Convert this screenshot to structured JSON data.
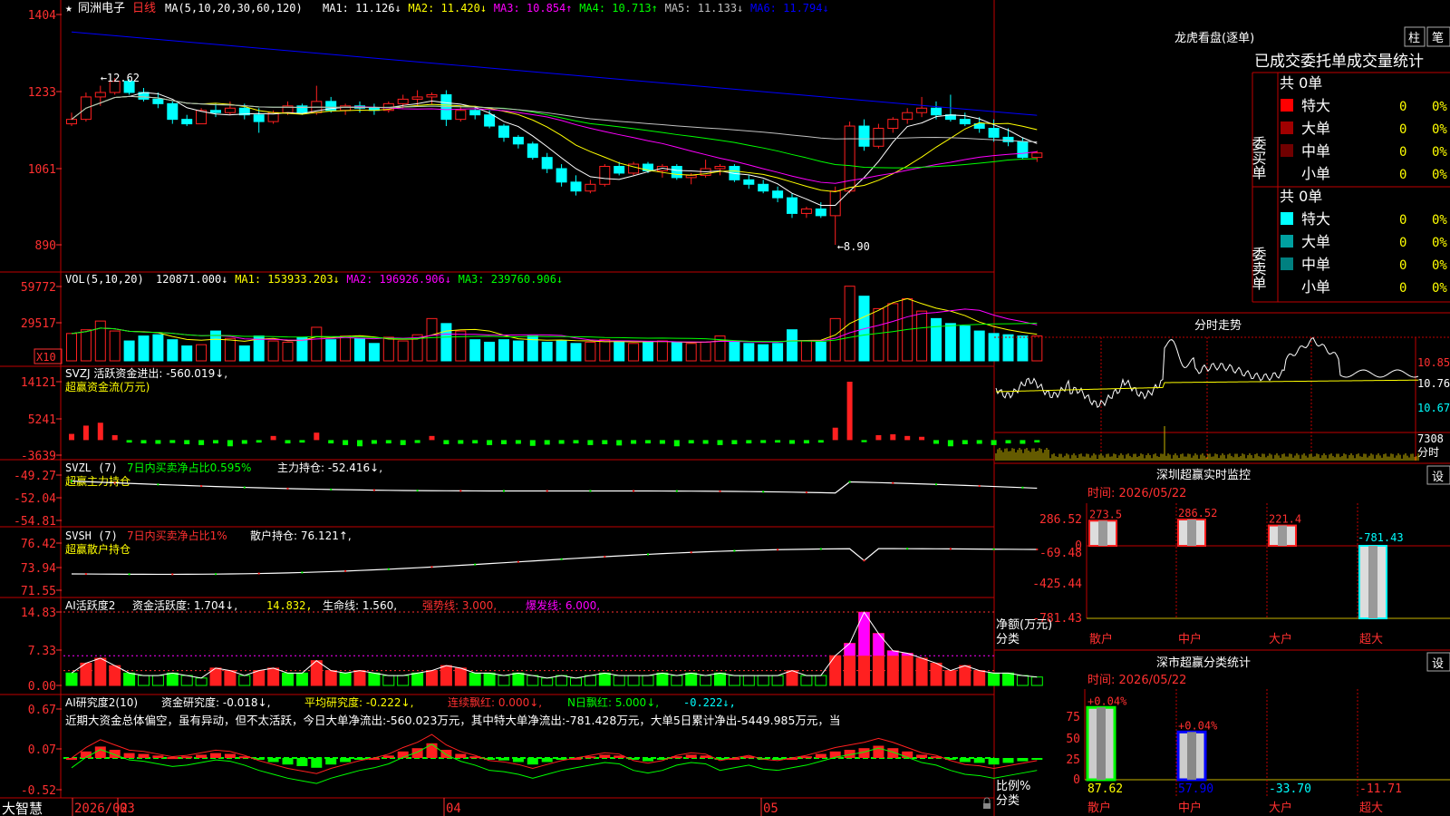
{
  "colors": {
    "up": "#ff2020",
    "down": "#00ffff",
    "ma5": "#ffffff",
    "ma10": "#ffff00",
    "ma20": "#ff00ff",
    "ma30": "#00ff00",
    "ma60": "#c0c0c0",
    "ma120": "#0000ff",
    "axis": "#c00000",
    "label_red": "#ff3030",
    "text_yellow": "#ffff00",
    "green": "#00ff00",
    "cyan": "#00ffff",
    "magenta": "#ff00ff"
  },
  "header": {
    "star": "★",
    "stock_name": "同洲电子",
    "period": "日线",
    "ma_caption": "MA(5,10,20,30,60,120)",
    "ma_values": [
      {
        "label": "MA1: 11.126↓",
        "color": "#ffffff"
      },
      {
        "label": "MA2: 11.420↓",
        "color": "#ffff00"
      },
      {
        "label": "MA3: 10.854↑",
        "color": "#ff00ff"
      },
      {
        "label": "MA4: 10.713↑",
        "color": "#00ff00"
      },
      {
        "label": "MA5: 11.133↓",
        "color": "#c0c0c0"
      },
      {
        "label": "MA6: 11.794↓",
        "color": "#0000ff"
      }
    ]
  },
  "price_panel": {
    "ticks": [
      "1404",
      "1233",
      "1061",
      "890"
    ],
    "high_label": "←12.62",
    "low_label": "←8.90"
  },
  "vol_panel": {
    "ticks": [
      "59772",
      "29517"
    ],
    "unit": "X10",
    "caption": "VOL(5,10,20)",
    "values": [
      {
        "label": "120871.000↓",
        "color": "#ffffff"
      },
      {
        "label": "MA1: 153933.203↓",
        "color": "#ffff00"
      },
      {
        "label": "MA2: 196926.906↓",
        "color": "#ff00ff"
      },
      {
        "label": "MA3: 239760.906↓",
        "color": "#00ff00"
      }
    ]
  },
  "svzj_panel": {
    "ticks": [
      "14121",
      "5241",
      "-3639"
    ],
    "caption": "SVZJ  活跃资金进出: -560.019↓,",
    "subcaption": "超赢资金流(万元)"
  },
  "svzl_panel": {
    "ticks": [
      "-49.27",
      "-52.04",
      "-54.81"
    ],
    "caption_a": "SVZL (7)",
    "caption_b": "7日内买卖净占比0.595%",
    "caption_c": "主力持仓: -52.416↓,",
    "subcaption": "超赢主力持仓"
  },
  "svsh_panel": {
    "ticks": [
      "76.42",
      "73.94",
      "71.55"
    ],
    "caption_a": "SVSH (7)",
    "caption_b": "7日内买卖净占比1%",
    "caption_c": "散户持仓: 76.121↑,",
    "subcaption": "超赢散户持仓"
  },
  "ai_active_panel": {
    "ticks": [
      "14.83",
      "7.33",
      "0.00"
    ],
    "caption_a": "AI活跃度2",
    "caption_b": "资金活跃度: 1.704↓,",
    "caption_c": "14.832,",
    "caption_d": "生命线: 1.560,",
    "caption_e": "强势线: 3.000,",
    "caption_f": "爆发线: 6.000,"
  },
  "ai_research_panel": {
    "ticks": [
      "0.67",
      "0.07",
      "-0.52"
    ],
    "caption_a": "AI研究度2(10)",
    "caption_b": "资金研究度: -0.018↓,",
    "caption_c": "平均研究度: -0.222↓,",
    "caption_d": "连续飘红: 0.000↓,",
    "caption_e": "N日飘红: 5.000↓,",
    "caption_f": "-0.222↓,",
    "commentary": "近期大资金总体偏空，虽有异动，但不太活跃，今日大单净流出:-560.023万元，其中特大单净流出:-781.428万元，大单5日累计净出-5449.985万元，当"
  },
  "bottom_axis": {
    "brand": "大智慧",
    "labels": [
      {
        "text": "2026/02",
        "x": 120
      },
      {
        "text": "03",
        "x": 170
      },
      {
        "text": "04",
        "x": 530
      },
      {
        "text": "05",
        "x": 880
      }
    ]
  },
  "right_panel": {
    "dragon_title": "龙虎看盘(逐单)",
    "btn_bar": "柱",
    "btn_pen": "笔",
    "stats_title": "已成交委托单成交量统计",
    "buy_side_label": "委买单",
    "sell_side_label": "委卖单",
    "buy_total": "共 0单",
    "sell_total": "共 0单",
    "buy_rows": [
      {
        "name": "特大",
        "count": "0",
        "pct": "0%",
        "swatch": "#ff0000"
      },
      {
        "name": "大单",
        "count": "0",
        "pct": "0%",
        "swatch": "#a00000"
      },
      {
        "name": "中单",
        "count": "0",
        "pct": "0%",
        "swatch": "#700000"
      },
      {
        "name": "小单",
        "count": "0",
        "pct": "0%",
        "swatch": ""
      }
    ],
    "sell_rows": [
      {
        "name": "特大",
        "count": "0",
        "pct": "0%",
        "swatch": "#00ffff"
      },
      {
        "name": "大单",
        "count": "0",
        "pct": "0%",
        "swatch": "#00a0a0"
      },
      {
        "name": "中单",
        "count": "0",
        "pct": "0%",
        "swatch": "#008080"
      },
      {
        "name": "小单",
        "count": "0",
        "pct": "0%",
        "swatch": ""
      }
    ],
    "intraday_title": "分时走势",
    "intraday_ticks": [
      "10.85",
      "10.76",
      "10.67"
    ],
    "intraday_vol_label": "7308",
    "intraday_vol_unit": "分时",
    "monitor_title": "深圳超赢实时监控",
    "monitor_btn": "设",
    "monitor_time": "时间: 2026/05/22",
    "monitor_ticks": [
      "286.52",
      "0",
      "-69.48",
      "-425.44",
      "-781.43"
    ],
    "monitor_ylabel": "净额(万元)",
    "monitor_xlabel": "分类",
    "classify_title": "深市超赢分类统计",
    "classify_btn": "设",
    "classify_time": "时间: 2026/05/22",
    "classify_ticks": [
      "75",
      "50",
      "25",
      "0"
    ],
    "classify_ylabel": "比例%",
    "classify_xlabel": "分类"
  },
  "chart_data": [
    {
      "type": "candlestick",
      "title": "同洲电子 日线",
      "ylim": [
        8.9,
        14.04
      ],
      "note": "per-day OHLC in yuan, read from chart",
      "ohlc": [
        [
          11.6,
          11.85,
          11.55,
          11.7
        ],
        [
          11.7,
          12.3,
          11.65,
          12.2
        ],
        [
          12.2,
          12.45,
          12.0,
          12.3
        ],
        [
          12.3,
          12.62,
          12.25,
          12.55
        ],
        [
          12.55,
          12.6,
          12.25,
          12.3
        ],
        [
          12.3,
          12.4,
          12.1,
          12.15
        ],
        [
          12.15,
          12.3,
          11.95,
          12.05
        ],
        [
          12.05,
          12.1,
          11.6,
          11.7
        ],
        [
          11.7,
          11.8,
          11.55,
          11.6
        ],
        [
          11.6,
          11.95,
          11.6,
          11.9
        ],
        [
          11.9,
          12.05,
          11.75,
          11.85
        ],
        [
          11.85,
          12.1,
          11.8,
          11.95
        ],
        [
          11.95,
          12.05,
          11.7,
          11.8
        ],
        [
          11.8,
          11.95,
          11.4,
          11.65
        ],
        [
          11.65,
          11.9,
          11.6,
          11.85
        ],
        [
          11.85,
          12.1,
          11.8,
          12.0
        ],
        [
          12.0,
          12.05,
          11.8,
          11.85
        ],
        [
          11.85,
          12.45,
          11.8,
          12.1
        ],
        [
          12.1,
          12.2,
          11.85,
          11.9
        ],
        [
          11.9,
          12.05,
          11.8,
          12.0
        ],
        [
          12.0,
          12.1,
          11.85,
          11.95
        ],
        [
          11.95,
          12.05,
          11.8,
          11.9
        ],
        [
          11.9,
          12.1,
          11.85,
          12.05
        ],
        [
          12.05,
          12.25,
          11.95,
          12.15
        ],
        [
          12.15,
          12.35,
          12.0,
          12.2
        ],
        [
          12.2,
          12.3,
          12.05,
          12.25
        ],
        [
          12.25,
          12.35,
          11.55,
          11.7
        ],
        [
          11.7,
          12.0,
          11.65,
          11.9
        ],
        [
          11.9,
          12.0,
          11.7,
          11.8
        ],
        [
          11.8,
          11.9,
          11.5,
          11.55
        ],
        [
          11.55,
          11.6,
          11.2,
          11.3
        ],
        [
          11.3,
          11.35,
          11.05,
          11.15
        ],
        [
          11.15,
          11.2,
          10.8,
          10.85
        ],
        [
          10.85,
          10.95,
          10.5,
          10.6
        ],
        [
          10.6,
          10.7,
          10.2,
          10.3
        ],
        [
          10.3,
          10.45,
          10.0,
          10.1
        ],
        [
          10.1,
          10.35,
          10.05,
          10.25
        ],
        [
          10.25,
          10.7,
          10.2,
          10.65
        ],
        [
          10.65,
          10.75,
          10.45,
          10.5
        ],
        [
          10.5,
          10.75,
          10.45,
          10.7
        ],
        [
          10.7,
          10.75,
          10.5,
          10.55
        ],
        [
          10.55,
          10.7,
          10.4,
          10.65
        ],
        [
          10.65,
          10.7,
          10.35,
          10.4
        ],
        [
          10.4,
          10.5,
          10.25,
          10.45
        ],
        [
          10.45,
          10.8,
          10.4,
          10.6
        ],
        [
          10.6,
          10.7,
          10.45,
          10.65
        ],
        [
          10.65,
          10.7,
          10.3,
          10.35
        ],
        [
          10.35,
          10.45,
          10.15,
          10.25
        ],
        [
          10.25,
          10.35,
          10.05,
          10.1
        ],
        [
          10.1,
          10.2,
          9.85,
          9.95
        ],
        [
          9.95,
          10.05,
          9.5,
          9.6
        ],
        [
          9.6,
          9.75,
          9.5,
          9.7
        ],
        [
          9.7,
          9.85,
          9.5,
          9.55
        ],
        [
          9.55,
          10.2,
          8.9,
          10.1
        ],
        [
          10.1,
          11.65,
          10.05,
          11.55
        ],
        [
          11.55,
          11.7,
          11.0,
          11.1
        ],
        [
          11.1,
          11.6,
          11.05,
          11.5
        ],
        [
          11.5,
          11.75,
          11.4,
          11.7
        ],
        [
          11.7,
          11.95,
          11.6,
          11.85
        ],
        [
          11.85,
          12.2,
          11.75,
          11.95
        ],
        [
          11.95,
          12.1,
          11.7,
          11.8
        ],
        [
          11.8,
          12.25,
          11.65,
          11.7
        ],
        [
          11.7,
          11.85,
          11.55,
          11.6
        ],
        [
          11.6,
          11.75,
          11.4,
          11.5
        ],
        [
          11.5,
          11.7,
          11.2,
          11.3
        ],
        [
          11.3,
          11.5,
          11.1,
          11.2
        ],
        [
          11.2,
          11.3,
          10.8,
          10.85
        ],
        [
          10.85,
          11.0,
          10.75,
          10.95
        ]
      ]
    },
    {
      "type": "bar",
      "title": "VOL(5,10,20)",
      "ylim": [
        0,
        59772
      ],
      "values": [
        22000,
        25000,
        32000,
        24000,
        16000,
        20000,
        21000,
        17000,
        12000,
        13000,
        24000,
        18000,
        12000,
        20000,
        16000,
        15000,
        19000,
        27000,
        17000,
        20000,
        18000,
        14000,
        19000,
        16000,
        21000,
        34000,
        30000,
        24000,
        17000,
        15000,
        17000,
        16000,
        20000,
        15000,
        16000,
        14000,
        15000,
        17000,
        16000,
        14000,
        15000,
        16000,
        15000,
        14000,
        15000,
        20000,
        15000,
        14000,
        13000,
        14000,
        25000,
        16000,
        15000,
        34000,
        60000,
        52000,
        42000,
        46000,
        50000,
        40000,
        34000,
        30000,
        28000,
        24000,
        22000,
        21000,
        20000,
        20000
      ]
    }
  ],
  "ai_active_values": [
    2.5,
    4.5,
    5.5,
    4.0,
    2.5,
    2.0,
    2.0,
    2.5,
    2.0,
    1.5,
    3.5,
    3.0,
    2.0,
    3.0,
    3.5,
    2.5,
    2.5,
    5.0,
    3.0,
    2.5,
    3.0,
    2.5,
    2.0,
    2.0,
    2.5,
    3.0,
    4.0,
    3.5,
    2.5,
    2.5,
    2.0,
    2.5,
    2.0,
    1.5,
    2.0,
    1.5,
    2.0,
    2.5,
    2.0,
    2.0,
    2.0,
    2.5,
    2.0,
    2.5,
    2.0,
    2.5,
    2.0,
    2.0,
    2.0,
    2.0,
    3.0,
    2.0,
    2.0,
    6.0,
    8.5,
    14.8,
    10.5,
    7.0,
    6.5,
    5.5,
    4.5,
    3.0,
    4.0,
    3.0,
    2.5,
    2.5,
    2.0,
    1.7
  ],
  "research_values": [
    0.0,
    0.08,
    0.14,
    0.1,
    0.06,
    0.05,
    0.03,
    0.01,
    0.02,
    0.04,
    0.06,
    0.05,
    0.02,
    -0.02,
    -0.05,
    -0.08,
    -0.1,
    -0.12,
    -0.08,
    -0.05,
    -0.02,
    0.0,
    0.03,
    0.08,
    0.12,
    0.18,
    0.1,
    0.05,
    0.02,
    -0.02,
    -0.03,
    -0.05,
    -0.08,
    -0.05,
    -0.02,
    0.0,
    0.02,
    0.04,
    0.03,
    -0.02,
    -0.04,
    -0.02,
    0.02,
    0.04,
    0.03,
    -0.02,
    0.0,
    0.02,
    -0.01,
    -0.02,
    0.0,
    0.02,
    0.05,
    0.08,
    0.1,
    0.12,
    0.15,
    0.12,
    0.08,
    0.04,
    0.02,
    -0.02,
    -0.05,
    -0.06,
    -0.08,
    -0.06,
    -0.04,
    -0.02
  ],
  "svzj_values": [
    1500,
    3500,
    4200,
    1200,
    -600,
    -800,
    -900,
    -700,
    -1000,
    -1200,
    -800,
    -1500,
    -900,
    -600,
    1000,
    -800,
    -600,
    1800,
    -800,
    -1200,
    -1500,
    -900,
    -800,
    -1200,
    -700,
    1000,
    -1000,
    -900,
    -800,
    -1200,
    -1000,
    -900,
    -1400,
    -1100,
    -900,
    -800,
    -1200,
    -1000,
    -1300,
    -900,
    -800,
    -900,
    -1500,
    -800,
    -900,
    -1200,
    -1000,
    -800,
    -700,
    -600,
    -900,
    -800,
    -600,
    3000,
    14121,
    -500,
    1200,
    1400,
    1000,
    800,
    -900,
    -1500,
    -1000,
    -900,
    -1200,
    -800,
    -900,
    -560
  ]
}
